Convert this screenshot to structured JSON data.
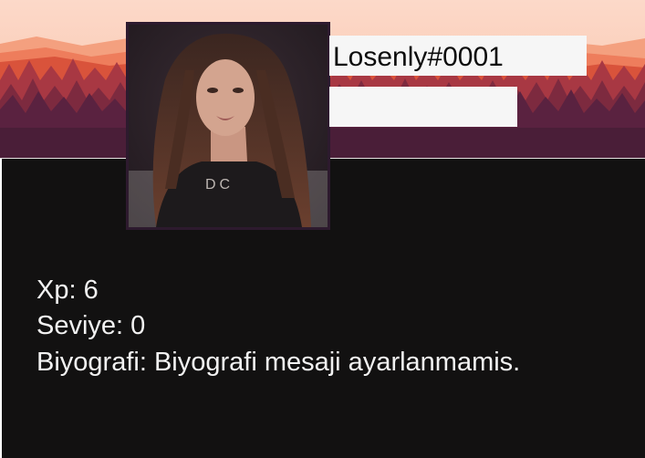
{
  "profile": {
    "username": "Losenly#0001",
    "subtitle": "",
    "xp_line": "Xp: 6",
    "level_line": "Seviye: 0",
    "bio_line": "Biyografi: Biyografi mesaji ayarlanmamis."
  },
  "colors": {
    "sky": "#fbd3c0",
    "mountain_far": "#f2866a",
    "mountain_mid": "#d9553a",
    "forest": "#8e2c3c",
    "forest_dark": "#4e1f39",
    "panel_bg": "#121111",
    "text": "#f2f2f2",
    "box_bg": "#f6f6f6"
  }
}
